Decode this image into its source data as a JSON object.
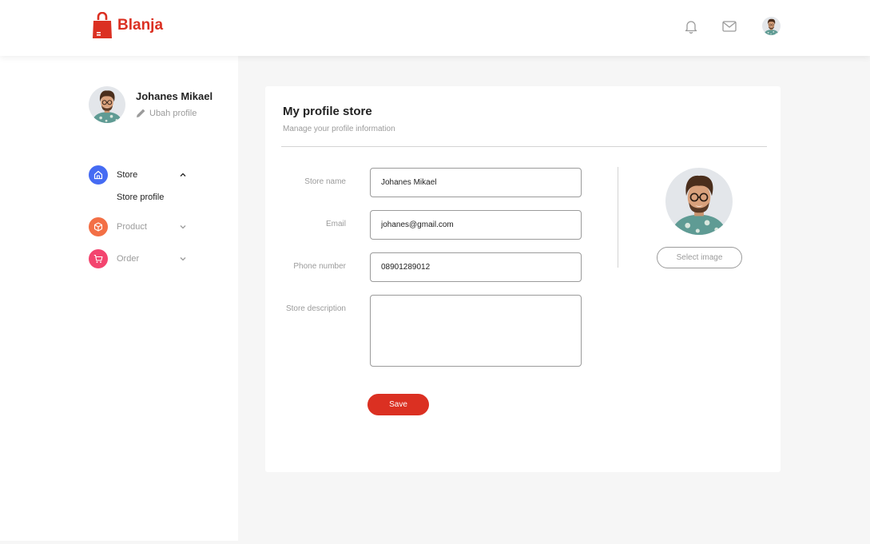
{
  "brand": {
    "name": "Blanja",
    "color": "#db3022"
  },
  "header": {
    "icons": [
      "bell-icon",
      "mail-icon"
    ],
    "avatar": "user-avatar"
  },
  "sidebar": {
    "user_name": "Johanes Mikael",
    "edit_label": "Ubah profile",
    "nav": [
      {
        "label": "Store",
        "icon": "home-icon",
        "color": "#456bf3",
        "expanded": true,
        "sub_items": [
          "Store profile"
        ]
      },
      {
        "label": "Product",
        "icon": "box-icon",
        "color": "#f36f45",
        "expanded": false
      },
      {
        "label": "Order",
        "icon": "cart-icon",
        "color": "#f3456f",
        "expanded": false
      }
    ]
  },
  "main": {
    "title": "My profile store",
    "subtitle": "Manage your profile information",
    "fields": {
      "store_name": {
        "label": "Store name",
        "value": "Johanes Mikael"
      },
      "email": {
        "label": "Email",
        "value": "johanes@gmail.com"
      },
      "phone": {
        "label": "Phone number",
        "value": "08901289012"
      },
      "description": {
        "label": "Store description",
        "value": ""
      }
    },
    "save_label": "Save",
    "select_image_label": "Select image"
  }
}
